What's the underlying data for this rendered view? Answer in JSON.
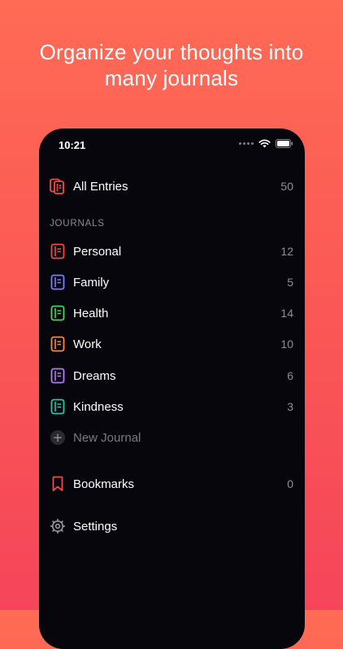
{
  "headline": {
    "line1": "Organize your thoughts into",
    "line2": "many journals"
  },
  "status_bar": {
    "time": "10:21",
    "icons": [
      "signal-dots-icon",
      "wifi-icon",
      "battery-icon"
    ]
  },
  "all_entries": {
    "label": "All Entries",
    "count": "50",
    "icon": "stacked-journals-icon",
    "color": "#f04a4a"
  },
  "journals_header": "JOURNALS",
  "journals": [
    {
      "label": "Personal",
      "count": "12",
      "color": "#f04a4a"
    },
    {
      "label": "Family",
      "count": "5",
      "color": "#7b7ff5"
    },
    {
      "label": "Health",
      "count": "14",
      "color": "#4fd15a"
    },
    {
      "label": "Work",
      "count": "10",
      "color": "#f58a3c"
    },
    {
      "label": "Dreams",
      "count": "6",
      "color": "#b47cf2"
    },
    {
      "label": "Kindness",
      "count": "3",
      "color": "#2ec4a6"
    }
  ],
  "new_journal": {
    "label": "New Journal",
    "icon": "plus-icon"
  },
  "bookmarks": {
    "label": "Bookmarks",
    "count": "0",
    "icon": "bookmark-icon",
    "color": "#f04a4a"
  },
  "settings": {
    "label": "Settings",
    "icon": "gear-icon"
  }
}
